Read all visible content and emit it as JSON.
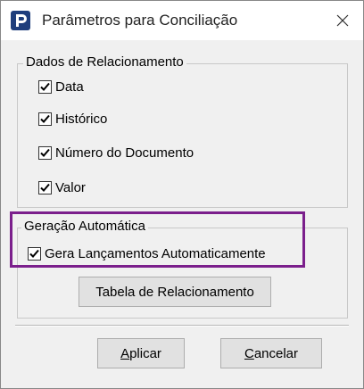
{
  "window": {
    "title": "Parâmetros para Conciliação",
    "app_icon": "app-logo-icon",
    "close_icon": "close-icon"
  },
  "relationship_group": {
    "legend": "Dados de Relacionamento",
    "items": [
      {
        "label": "Data",
        "checked": true
      },
      {
        "label": "Histórico",
        "checked": true
      },
      {
        "label": "Número do Documento",
        "checked": true
      },
      {
        "label": "Valor",
        "checked": true
      }
    ]
  },
  "auto_group": {
    "legend": "Geração Automática",
    "checkbox_label": "Gera Lançamentos Automaticamente",
    "checked": true,
    "table_button_label": "Tabela de Relacionamento"
  },
  "buttons": {
    "apply_first": "A",
    "apply_rest": "plicar",
    "cancel_first": "C",
    "cancel_rest": "ancelar"
  },
  "colors": {
    "highlight": "#7b1f8c",
    "app_icon_bg": "#1f3e7c"
  }
}
